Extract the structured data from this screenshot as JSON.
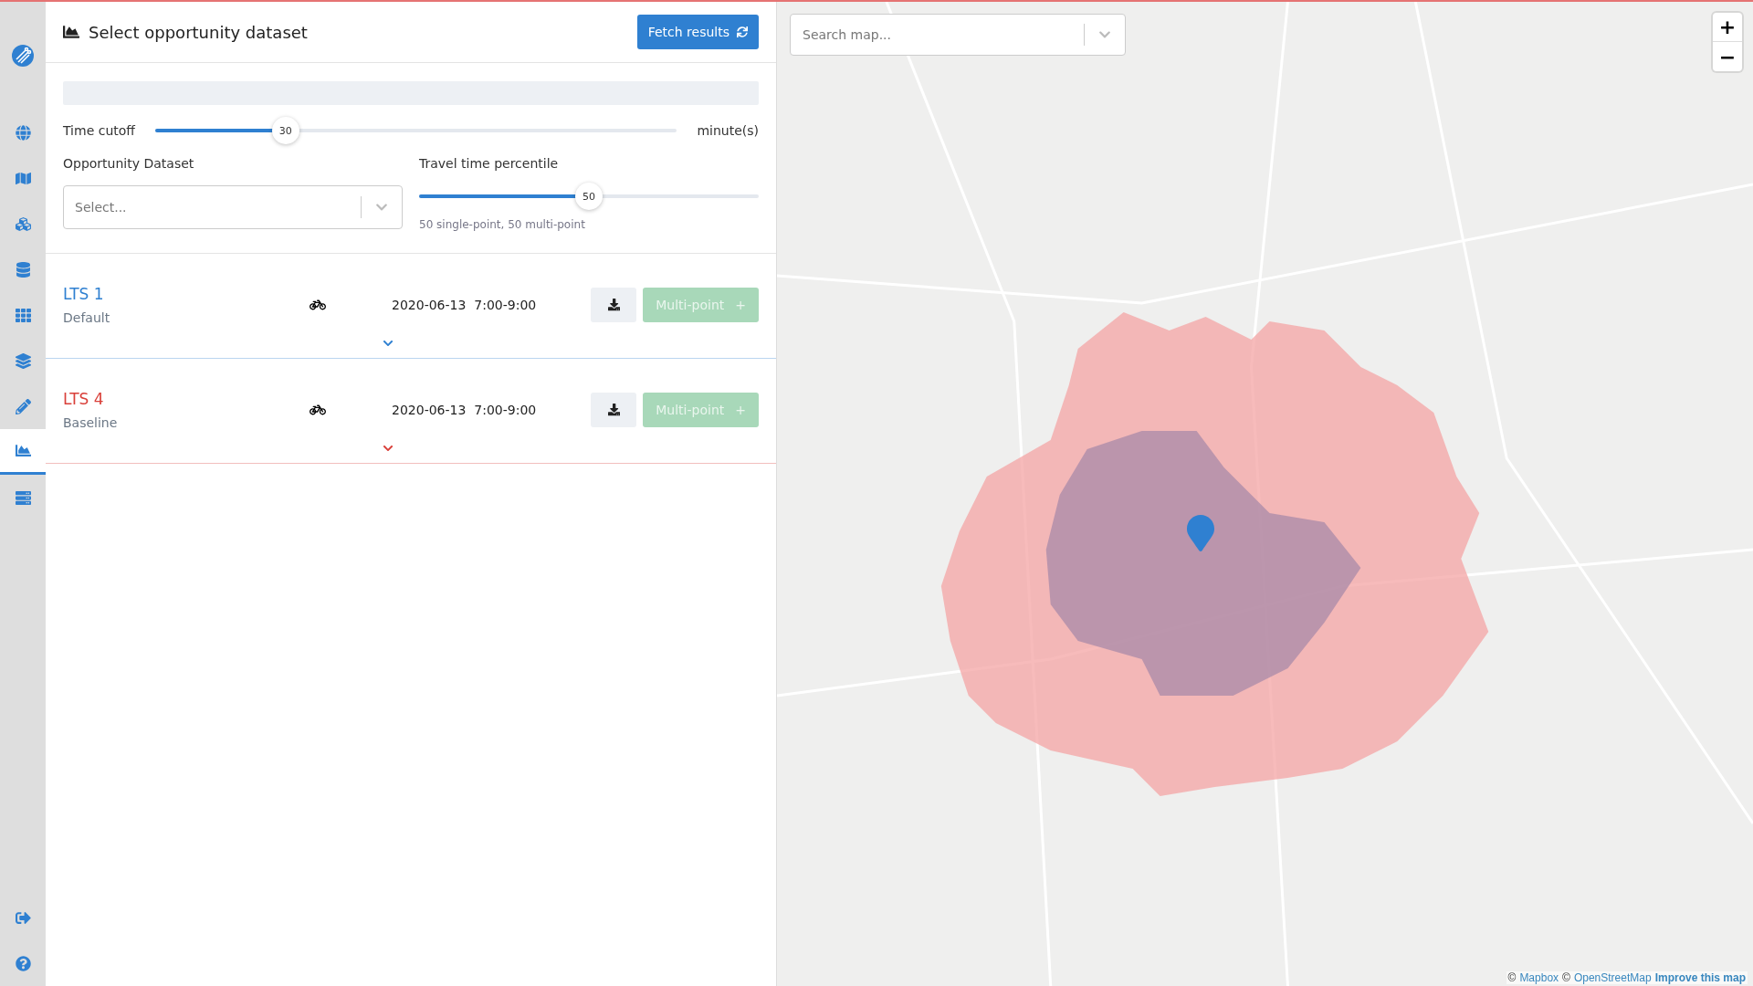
{
  "sidebar": {
    "items": [
      {
        "kind": "globe",
        "selected": false
      },
      {
        "kind": "map",
        "selected": false
      },
      {
        "kind": "cubes",
        "selected": false
      },
      {
        "kind": "database",
        "selected": false
      },
      {
        "kind": "grid",
        "selected": false
      },
      {
        "kind": "layers",
        "selected": false
      },
      {
        "kind": "pencil",
        "selected": false
      },
      {
        "kind": "chart",
        "selected": true
      },
      {
        "kind": "server",
        "selected": false
      }
    ],
    "bottom_items": [
      {
        "kind": "signout",
        "selected": false
      },
      {
        "kind": "help",
        "selected": false
      }
    ]
  },
  "panel": {
    "title": "Select opportunity dataset",
    "fetch_button": "Fetch results",
    "time_cutoff": {
      "label": "Time cutoff",
      "reading": "30",
      "level": 0.25,
      "unit": "minute(s)"
    },
    "dataset": {
      "label": "Opportunity Dataset",
      "placeholder": "Select..."
    },
    "percentile": {
      "label": "Travel time percentile",
      "reading": "50",
      "level": 0.5,
      "note": "50 single-point, 50 multi-point"
    }
  },
  "results": [
    {
      "name": "LTS 1",
      "subtitle": "Default",
      "color": "#2f80d1",
      "date": "2020-06-13",
      "time": "7:00-9:00",
      "button": "Multi-point",
      "button_icon": "+"
    },
    {
      "name": "LTS 4",
      "subtitle": "Baseline",
      "color": "#d9403a",
      "date": "2020-06-13",
      "time": "7:00-9:00",
      "button": "Multi-point",
      "button_icon": "+"
    }
  ],
  "map": {
    "search": {
      "placeholder": "Search map..."
    },
    "zoom_in": "+",
    "zoom_out": "−",
    "attribution": [
      {
        "kind": "plain",
        "text": "©"
      },
      {
        "kind": "link",
        "text": "Mapbox"
      },
      {
        "kind": "plain",
        "text": "©"
      },
      {
        "kind": "link",
        "text": "OpenStreetMap"
      },
      {
        "kind": "bold",
        "text": "Improve this map"
      }
    ]
  }
}
